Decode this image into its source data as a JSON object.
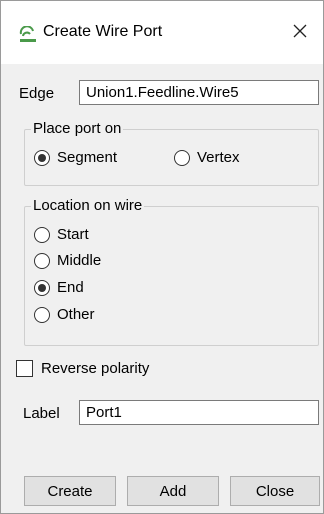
{
  "window": {
    "title": "Create Wire Port"
  },
  "edge": {
    "label": "Edge",
    "value": "Union1.Feedline.Wire5"
  },
  "place_port_on": {
    "title": "Place port on",
    "options": [
      {
        "label": "Segment",
        "selected": true
      },
      {
        "label": "Vertex",
        "selected": false
      }
    ]
  },
  "location_on_wire": {
    "title": "Location on wire",
    "options": [
      {
        "label": "Start",
        "selected": false
      },
      {
        "label": "Middle",
        "selected": false
      },
      {
        "label": "End",
        "selected": true
      },
      {
        "label": "Other",
        "selected": false
      }
    ]
  },
  "reverse_polarity": {
    "label": "Reverse polarity",
    "checked": false
  },
  "port_label": {
    "label": "Label",
    "value": "Port1"
  },
  "buttons": {
    "create": "Create",
    "add": "Add",
    "close": "Close"
  },
  "colors": {
    "icon_green": "#4a9a4a",
    "window_bg": "#f0f0f0",
    "button_bg": "#e1e1e1"
  }
}
